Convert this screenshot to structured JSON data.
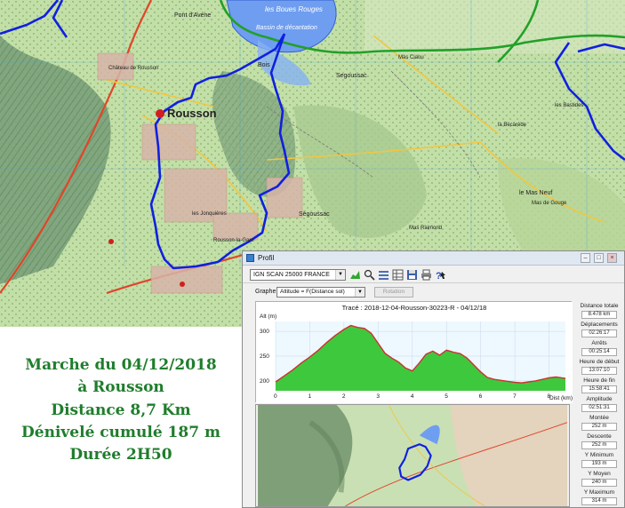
{
  "map_labels": {
    "boues_rouges": "les Boues Rouges",
    "bassin": "Bassin de décantation",
    "pont_avene": "Pont d'Avène",
    "chateau": "Château de Rousson",
    "rousson": "Rousson",
    "segoussac_north": "Segoussac",
    "segoussac_south": "Ségoussac",
    "les_jonquieres": "les Jonquières",
    "rousson_gare": "Rousson-la-Gare",
    "mas_neuf": "le Mas Neuf",
    "mas_gouge": "Mas de Gouge",
    "les_bastides": "les Bastides",
    "mas_ciaou": "Mas Ciaou",
    "la_bécarède": "la Bécarède",
    "mas_raimond": "Mas Raimond",
    "bois": "Bois"
  },
  "route_info": {
    "line1": "Marche du 04/12/2018",
    "line2": "à Rousson",
    "line3": "Distance  8,7 Km",
    "line4": "Dénivelé cumulé 187 m",
    "line5": "Durée  2H50"
  },
  "window": {
    "title": "Profil",
    "map_select_value": "IGN SCAN 25000 FRANCE",
    "graphe_label": "Graphe",
    "graphe_value": "Altitude = F(Distance sol)",
    "rotation_label": "Rotation"
  },
  "chart_data": {
    "type": "area",
    "title": "Tracé : 2018-12-04-Rousson-30223-R - 04/12/18",
    "ylabel": "Alt (m)",
    "xlabel": "Dist (km)",
    "xlim": [
      0,
      8.48
    ],
    "ylim": [
      180,
      320
    ],
    "x_ticks": [
      0,
      1,
      2,
      3,
      4,
      5,
      6,
      7,
      8
    ],
    "y_ticks": [
      200,
      250,
      300
    ],
    "fill_color": "#3ec83e",
    "line_color": "#d03030",
    "x": [
      0,
      0.25,
      0.5,
      0.75,
      1.0,
      1.25,
      1.5,
      1.75,
      2.0,
      2.2,
      2.4,
      2.6,
      2.8,
      3.0,
      3.2,
      3.4,
      3.6,
      3.8,
      4.0,
      4.2,
      4.4,
      4.6,
      4.8,
      5.0,
      5.2,
      5.4,
      5.6,
      5.8,
      6.0,
      6.2,
      6.4,
      6.6,
      6.8,
      7.0,
      7.2,
      7.4,
      7.6,
      7.8,
      8.0,
      8.2,
      8.48
    ],
    "y": [
      198,
      210,
      222,
      236,
      248,
      262,
      278,
      292,
      304,
      312,
      308,
      306,
      296,
      276,
      256,
      246,
      238,
      226,
      220,
      236,
      254,
      260,
      252,
      262,
      258,
      255,
      246,
      232,
      218,
      207,
      203,
      201,
      199,
      197,
      196,
      198,
      200,
      203,
      206,
      208,
      205
    ]
  },
  "stats": [
    {
      "label": "Distance totale",
      "value": "8.478 km"
    },
    {
      "label": "Déplacements",
      "value": "02:26:17"
    },
    {
      "label": "Arrêts",
      "value": "00:25:14"
    },
    {
      "label": "Heure de début",
      "value": "13:07:10"
    },
    {
      "label": "Heure de fin",
      "value": "15:58:41"
    },
    {
      "label": "Amplitude",
      "value": "02:51:31"
    },
    {
      "label": "Montée",
      "value": "252 m"
    },
    {
      "label": "Descente",
      "value": "252 m"
    },
    {
      "label": "Y Minimum",
      "value": "193 m"
    },
    {
      "label": "Y Moyen",
      "value": "240 m"
    },
    {
      "label": "Y Maximum",
      "value": "314 m"
    }
  ],
  "colors": {
    "route": "#1020e0",
    "green_path": "#22a028",
    "info_text": "#1f7d2c",
    "water": "#5a8fe0"
  },
  "icons": [
    "chart-icon",
    "zoom-icon",
    "list-icon",
    "grid-icon",
    "save-icon",
    "print-icon",
    "help-icon"
  ]
}
